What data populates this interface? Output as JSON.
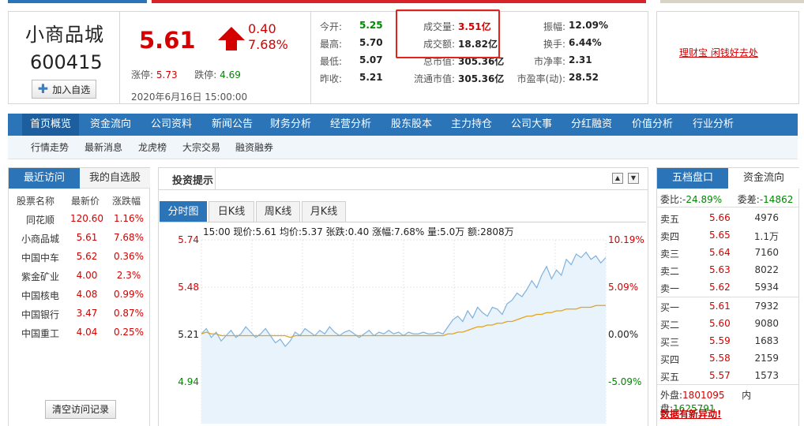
{
  "stock": {
    "name": "小商品城",
    "code": "600415",
    "add_watch": "加入自选",
    "price": "5.61",
    "change": "0.40",
    "change_pct": "7.68%",
    "limit_up_label": "涨停:",
    "limit_up": "5.73",
    "limit_down_label": "跌停:",
    "limit_down": "4.69",
    "datetime": "2020年6月16日 15:00:00"
  },
  "stats": [
    [
      {
        "label": "今开:",
        "value": "5.25",
        "color": "green"
      },
      {
        "label": "成交量:",
        "value": "3.51亿",
        "color": "red"
      },
      {
        "label": "振幅:",
        "value": "12.09%",
        "color": "dark"
      }
    ],
    [
      {
        "label": "最高:",
        "value": "5.70",
        "color": "dark"
      },
      {
        "label": "成交额:",
        "value": "18.82亿",
        "color": "dark"
      },
      {
        "label": "换手:",
        "value": "6.44%",
        "color": "dark"
      }
    ],
    [
      {
        "label": "最低:",
        "value": "5.07",
        "color": "dark"
      },
      {
        "label": "总市值:",
        "value": "305.36亿",
        "color": "dark"
      },
      {
        "label": "市净率:",
        "value": "2.31",
        "color": "dark"
      }
    ],
    [
      {
        "label": "昨收:",
        "value": "5.21",
        "color": "dark"
      },
      {
        "label": "流通市值:",
        "value": "305.36亿",
        "color": "dark"
      },
      {
        "label": "市盈率(动):",
        "value": "28.52",
        "color": "dark"
      }
    ]
  ],
  "ad_text": "理财宝 闲钱好去处",
  "main_nav": [
    "首页概览",
    "资金流向",
    "公司资料",
    "新闻公告",
    "财务分析",
    "经营分析",
    "股东股本",
    "主力持仓",
    "公司大事",
    "分红融资",
    "价值分析",
    "行业分析"
  ],
  "sub_nav": [
    "行情走势",
    "最新消息",
    "龙虎榜",
    "大宗交易",
    "融资融券"
  ],
  "left_panel": {
    "tabs": [
      "最近访问",
      "我的自选股"
    ],
    "headers": [
      "股票名称",
      "最新价",
      "涨跌幅"
    ],
    "rows": [
      {
        "name": "同花顺",
        "price": "120.60",
        "pct": "1.16%"
      },
      {
        "name": "小商品城",
        "price": "5.61",
        "pct": "7.68%"
      },
      {
        "name": "中国中车",
        "price": "5.62",
        "pct": "0.36%"
      },
      {
        "name": "紫金矿业",
        "price": "4.00",
        "pct": "2.3%"
      },
      {
        "name": "中国核电",
        "price": "4.08",
        "pct": "0.99%"
      },
      {
        "name": "中国银行",
        "price": "3.47",
        "pct": "0.87%"
      },
      {
        "name": "中国重工",
        "price": "4.04",
        "pct": "0.25%"
      }
    ],
    "clear_btn": "清空访问记录"
  },
  "chart_panel": {
    "title": "投资提示",
    "tabs": [
      "分时图",
      "日K线",
      "周K线",
      "月K线"
    ],
    "info": "15:00 现价:5.61 均价:5.37 张跌:0.40 涨幅:7.68% 量:5.0万 额:2808万"
  },
  "chart_data": {
    "type": "line",
    "y_ticks": [
      "5.74",
      "5.48",
      "5.21",
      "4.94"
    ],
    "pct_ticks": [
      "10.19%",
      "5.09%",
      "0.00%",
      "-5.09%"
    ],
    "ylim": [
      4.94,
      5.74
    ],
    "prev_close": 5.21,
    "series": [
      {
        "values": [
          5.21,
          5.24,
          5.19,
          5.22,
          5.17,
          5.2,
          5.23,
          5.19,
          5.21,
          5.25,
          5.22,
          5.19,
          5.21,
          5.24,
          5.2,
          5.16,
          5.18,
          5.14,
          5.17,
          5.22,
          5.2,
          5.24,
          5.22,
          5.2,
          5.23,
          5.21,
          5.25,
          5.22,
          5.2,
          5.22,
          5.23,
          5.21,
          5.19,
          5.21,
          5.23,
          5.2,
          5.22,
          5.21,
          5.23,
          5.21,
          5.22,
          5.2,
          5.22,
          5.21,
          5.21,
          5.22,
          5.21,
          5.21,
          5.22,
          5.21,
          5.25,
          5.29,
          5.31,
          5.28,
          5.34,
          5.3,
          5.36,
          5.33,
          5.31,
          5.36,
          5.35,
          5.32,
          5.38,
          5.4,
          5.44,
          5.42,
          5.46,
          5.51,
          5.47,
          5.54,
          5.59,
          5.52,
          5.57,
          5.54,
          5.63,
          5.6,
          5.66,
          5.64,
          5.67,
          5.63,
          5.65,
          5.61,
          5.64
        ]
      },
      {
        "values": [
          5.21,
          5.22,
          5.21,
          5.21,
          5.2,
          5.2,
          5.2,
          5.2,
          5.2,
          5.2,
          5.2,
          5.2,
          5.2,
          5.2,
          5.2,
          5.2,
          5.2,
          5.2,
          5.19,
          5.2,
          5.2,
          5.2,
          5.2,
          5.2,
          5.2,
          5.2,
          5.2,
          5.2,
          5.2,
          5.2,
          5.2,
          5.2,
          5.2,
          5.2,
          5.2,
          5.2,
          5.2,
          5.2,
          5.2,
          5.2,
          5.2,
          5.2,
          5.2,
          5.2,
          5.2,
          5.2,
          5.2,
          5.2,
          5.2,
          5.2,
          5.21,
          5.21,
          5.22,
          5.22,
          5.23,
          5.24,
          5.25,
          5.25,
          5.26,
          5.26,
          5.27,
          5.27,
          5.28,
          5.28,
          5.29,
          5.3,
          5.31,
          5.31,
          5.32,
          5.32,
          5.33,
          5.33,
          5.34,
          5.34,
          5.35,
          5.35,
          5.35,
          5.36,
          5.36,
          5.36,
          5.37,
          5.37,
          5.37
        ]
      }
    ]
  },
  "order_book": {
    "tabs": [
      "五档盘口",
      "资金流向"
    ],
    "ratio_label": "委比:",
    "ratio": "-24.89%",
    "diff_label": "委差:",
    "diff": "-14862",
    "sells": [
      {
        "label": "卖五",
        "price": "5.66",
        "vol": "4976"
      },
      {
        "label": "卖四",
        "price": "5.65",
        "vol": "1.1万"
      },
      {
        "label": "卖三",
        "price": "5.64",
        "vol": "7160"
      },
      {
        "label": "卖二",
        "price": "5.63",
        "vol": "8022"
      },
      {
        "label": "卖一",
        "price": "5.62",
        "vol": "5934"
      }
    ],
    "buys": [
      {
        "label": "买一",
        "price": "5.61",
        "vol": "7932"
      },
      {
        "label": "买二",
        "price": "5.60",
        "vol": "9080"
      },
      {
        "label": "买三",
        "price": "5.59",
        "vol": "1683"
      },
      {
        "label": "买四",
        "price": "5.58",
        "vol": "2159"
      },
      {
        "label": "买五",
        "price": "5.57",
        "vol": "1573"
      }
    ],
    "outer_label": "外盘:",
    "outer": "1801095",
    "inner_label": "内盘:",
    "inner": "1625791",
    "alert": "数据有新异动!"
  },
  "colors": {
    "accent": "#2a74b7",
    "up": "#d40000",
    "down": "#008800",
    "highlight": "#e0231c"
  }
}
